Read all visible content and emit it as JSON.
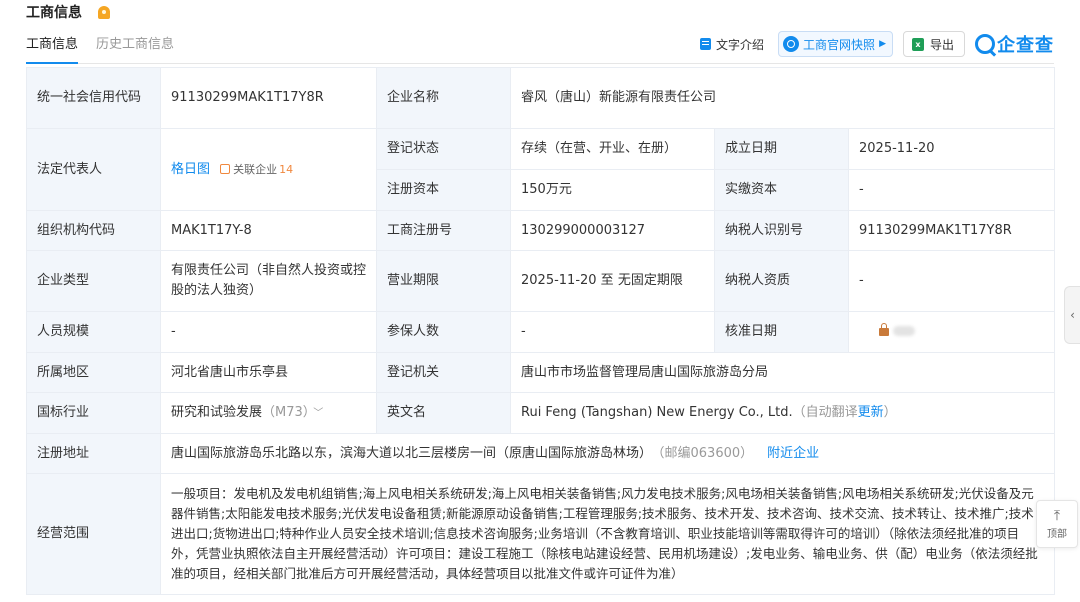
{
  "header": {
    "title": "工商信息"
  },
  "tabs": [
    {
      "label": "工商信息",
      "active": true
    },
    {
      "label": "历史工商信息",
      "active": false
    }
  ],
  "toolbar": {
    "text_intro": "文字介绍",
    "official_snapshot": "工商官网快照",
    "export": "导出",
    "logo": "企查查"
  },
  "rows": {
    "credit_code": {
      "label": "统一社会信用代码",
      "value": "91130299MAK1T17Y8R"
    },
    "company_name": {
      "label": "企业名称",
      "value": "睿风（唐山）新能源有限责任公司"
    },
    "legal_rep": {
      "label": "法定代表人",
      "name": "格日图",
      "related_label": "关联企业",
      "related_count": "14"
    },
    "status": {
      "label": "登记状态",
      "value": "存续（在营、开业、在册）"
    },
    "established": {
      "label": "成立日期",
      "value": "2025-11-20"
    },
    "reg_capital": {
      "label": "注册资本",
      "value": "150万元"
    },
    "paid_capital": {
      "label": "实缴资本",
      "value": "-"
    },
    "org_code": {
      "label": "组织机构代码",
      "value": "MAK1T17Y-8"
    },
    "reg_no": {
      "label": "工商注册号",
      "value": "130299000003127"
    },
    "taxpayer_id": {
      "label": "纳税人识别号",
      "value": "91130299MAK1T17Y8R"
    },
    "company_type": {
      "label": "企业类型",
      "value": "有限责任公司（非自然人投资或控股的法人独资）"
    },
    "business_term": {
      "label": "营业期限",
      "value": "2025-11-20 至 无固定期限"
    },
    "taxpayer_qual": {
      "label": "纳税人资质",
      "value": "-"
    },
    "staff_size": {
      "label": "人员规模",
      "value": "-"
    },
    "insured": {
      "label": "参保人数",
      "value": "-"
    },
    "approval_date": {
      "label": "核准日期"
    },
    "region": {
      "label": "所属地区",
      "value": "河北省唐山市乐亭县"
    },
    "authority": {
      "label": "登记机关",
      "value": "唐山市市场监督管理局唐山国际旅游岛分局"
    },
    "industry": {
      "label": "国标行业",
      "value": "研究和试验发展",
      "code": "（M73）"
    },
    "english_name": {
      "label": "英文名",
      "value": "Rui Feng (Tangshan) New Energy Co., Ltd.",
      "auto_translate": "（自动翻译",
      "update": "更新",
      "close_paren": "）"
    },
    "address": {
      "label": "注册地址",
      "value": "唐山国际旅游岛乐北路以东，滨海大道以北三层楼房一间（原唐山国际旅游岛林场）",
      "postcode": "（邮编063600）",
      "nearby": "附近企业"
    },
    "scope": {
      "label": "经营范围",
      "value": "一般项目：发电机及发电机组销售;海上风电相关系统研发;海上风电相关装备销售;风力发电技术服务;风电场相关装备销售;风电场相关系统研发;光伏设备及元器件销售;太阳能发电技术服务;光伏发电设备租赁;新能源原动设备销售;工程管理服务;技术服务、技术开发、技术咨询、技术交流、技术转让、技术推广;技术进出口;货物进出口;特种作业人员安全技术培训;信息技术咨询服务;业务培训（不含教育培训、职业技能培训等需取得许可的培训）（除依法须经批准的项目外，凭营业执照依法自主开展经营活动）许可项目：建设工程施工（除核电站建设经营、民用机场建设）;发电业务、输电业务、供（配）电业务（依法须经批准的项目，经相关部门批准后方可开展经营活动，具体经营项目以批准文件或许可证件为准）"
    }
  },
  "side": {
    "to_top": "顶部"
  },
  "colors": {
    "accent": "#128bed",
    "label_bg": "#f2f6fb",
    "border": "#e9edf3",
    "orange": "#f0883e"
  }
}
